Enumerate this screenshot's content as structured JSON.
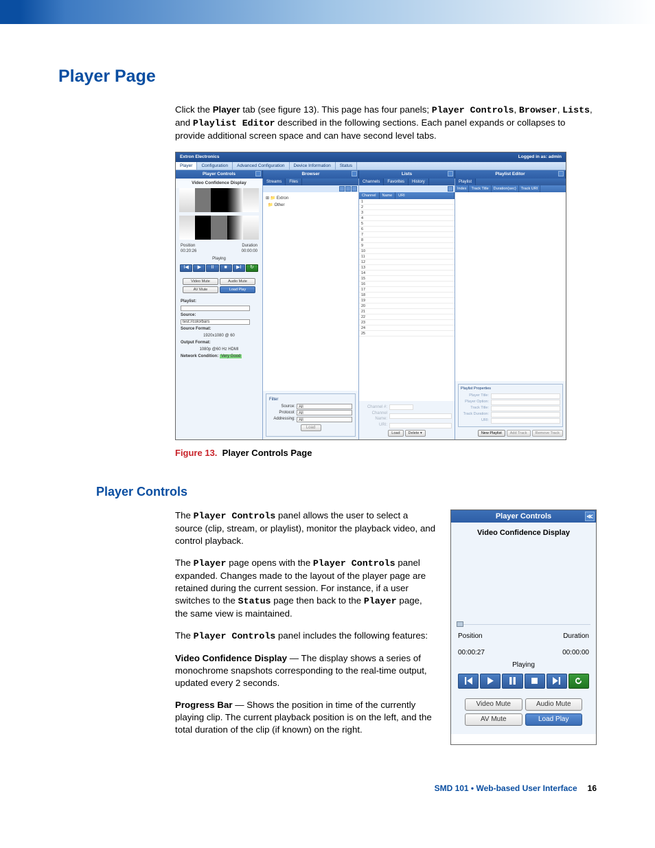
{
  "headings": {
    "h1": "Player Page",
    "h2": "Player Controls"
  },
  "intro": {
    "pre1": "Click the ",
    "tab": "Player",
    "post1": " tab (see figure 13). This page has four panels; ",
    "m1": "Player Controls",
    "c1": ", ",
    "m2": "Browser",
    "c2": ", ",
    "m3": "Lists",
    "c3": ", and ",
    "m4": "Playlist Editor",
    "post2": " described in the following sections. Each panel expands or collapses to provide additional screen space and can have second level tabs."
  },
  "fig": {
    "title": "Extron Electronics",
    "login": "Logged in as: admin",
    "tabs": [
      "Player",
      "Configuration",
      "Advanced Configuration",
      "Device Information",
      "Status"
    ],
    "panels": [
      "Player Controls",
      "Browser",
      "Lists",
      "Playlist Editor"
    ],
    "vcd": "Video Confidence Display",
    "posLbl": "Position",
    "pos": "00:20:26",
    "durLbl": "Duration",
    "dur": "00:00:00",
    "state": "Playing",
    "mutes": [
      "Video Mute",
      "Audio Mute",
      "AV Mute",
      "Load Play"
    ],
    "form": {
      "playlist": "Playlist:",
      "source": "Source:",
      "sourceVal": "test://colorbars",
      "sourceFmt": "Source Format:",
      "sourceFmtVal": "1920x1080 @ 60",
      "outFmt": "Output Format:",
      "outFmtVal": "1080p @60 Hz HDMI",
      "net": "Network Condition:",
      "netVal": "Very Good"
    },
    "browserTabs": [
      "Streams",
      "Files"
    ],
    "treeItems": [
      "Extron",
      "Other"
    ],
    "filter": {
      "legend": "Filter",
      "source": "Source:",
      "protocol": "Protocol:",
      "addressing": "Addressing:",
      "all": "All",
      "load": "Load"
    },
    "listsTabs": [
      "Channels",
      "Favorites",
      "History"
    ],
    "listCols": [
      "Channel",
      "Name",
      "URI"
    ],
    "detail": {
      "channel": "Channel #:",
      "cname": "Channel Name:",
      "uri": "URI:",
      "load": "Load",
      "delete": "Delete"
    },
    "peHdr": "Playlist",
    "peCols": [
      "Index",
      "Track Title",
      "Duration(sec)",
      "Track URI"
    ],
    "props": {
      "legend": "Playlist Properties",
      "player": "Player Title:",
      "option": "Player Option:",
      "track": "Track Title:",
      "dur": "Track Duration:",
      "uri": "URI:"
    },
    "peBtns": [
      "New Playlist",
      "Add Track",
      "Remove Track"
    ]
  },
  "caption": {
    "figno": "Figure 13.",
    "text": "Player Controls Page"
  },
  "pc": {
    "p1a": "The ",
    "p1m": "Player Controls",
    "p1b": " panel allows the user to select a source (clip, stream, or playlist), monitor the playback video, and control playback.",
    "p2a": "The ",
    "p2m1": "Player",
    "p2b": " page opens with the ",
    "p2m2": "Player Controls",
    "p2c": " panel expanded. Changes made to the layout of the player page are retained during the current session. For instance, if a user switches to the ",
    "p2m3": "Status",
    "p2d": " page then back to the ",
    "p2m4": "Player",
    "p2e": " page, the same view is maintained.",
    "p3a": "The ",
    "p3m": "Player Controls",
    "p3b": " panel includes the following features:",
    "vcdLbl": "Video Confidence Display",
    "vcdTxt": " — The display shows a series of monochrome snapshots corresponding to the real-time output, updated every 2 seconds.",
    "pbLbl": "Progress Bar",
    "pbTxt": " — Shows the position in time of the currently playing clip. The current playback position is on the left, and the total duration of the clip (if known) on the right."
  },
  "panel2": {
    "title": "Player Controls",
    "vcd": "Video Confidence Display",
    "posLbl": "Position",
    "pos": "00:00:27",
    "durLbl": "Duration",
    "dur": "00:00:00",
    "state": "Playing",
    "mutes": [
      "Video Mute",
      "Audio Mute",
      "AV Mute",
      "Load Play"
    ]
  },
  "footer": {
    "title": "SMD 101 • Web-based User Interface",
    "page": "16"
  }
}
